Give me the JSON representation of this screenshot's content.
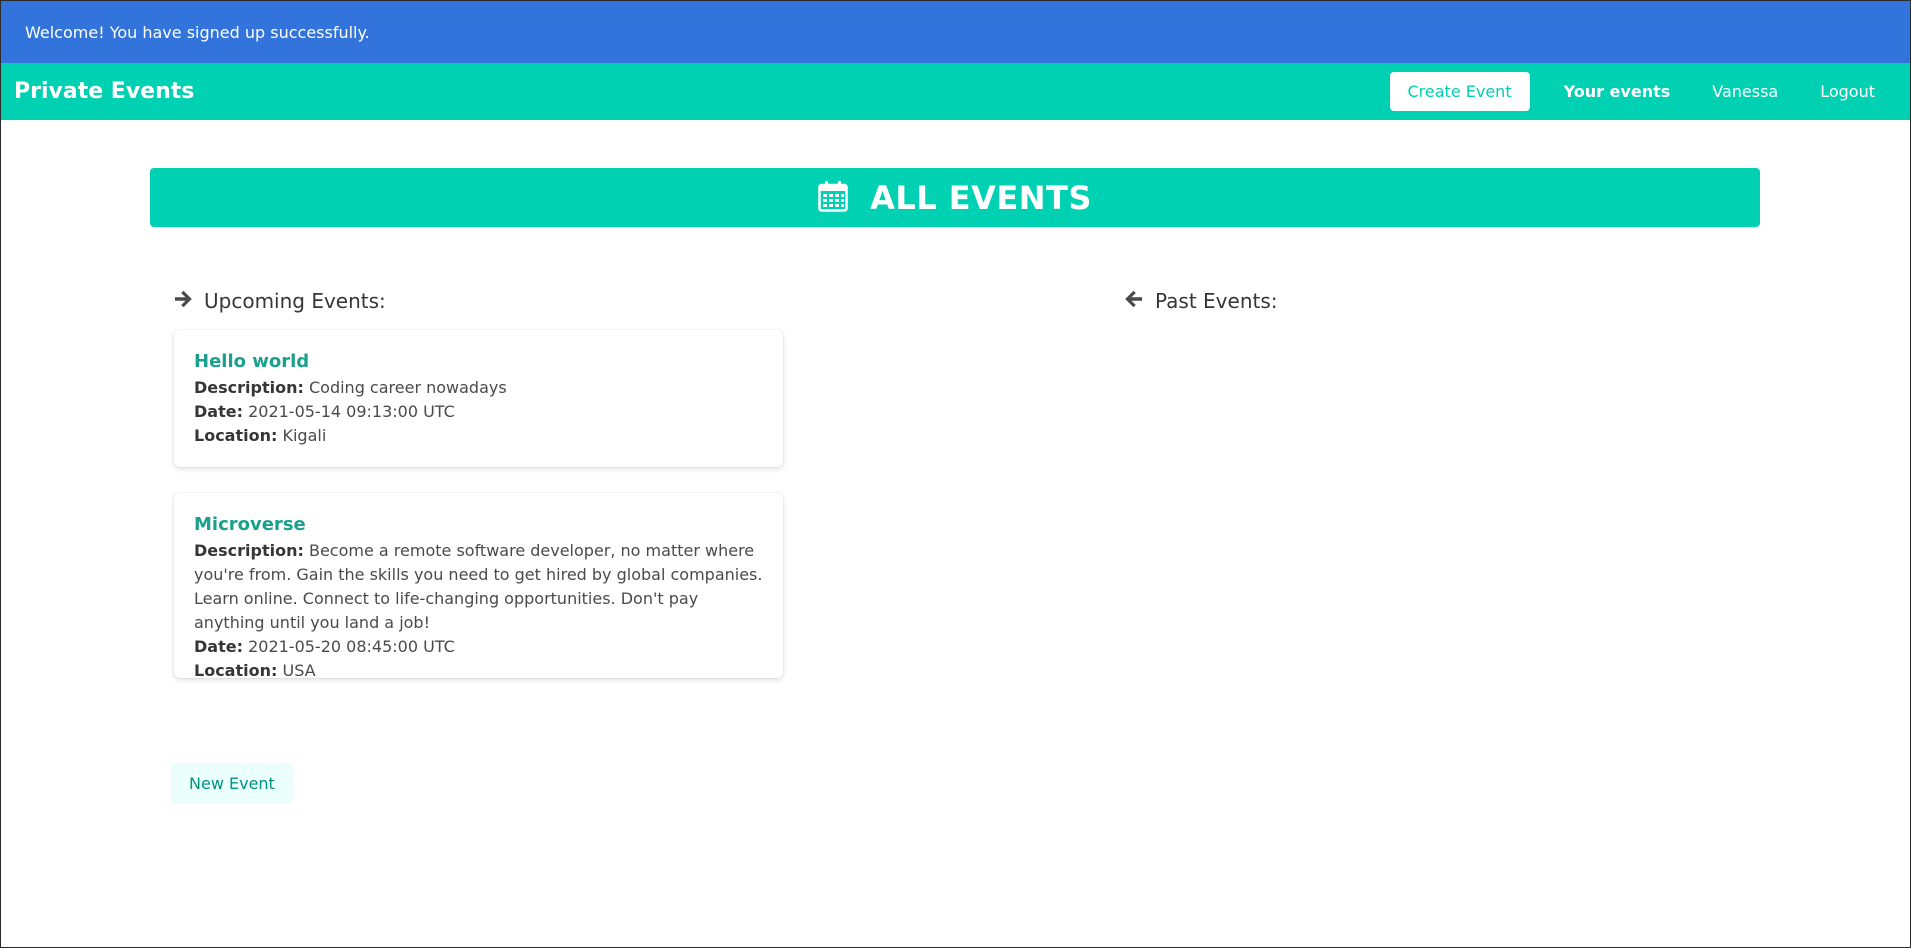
{
  "flash": {
    "message": "Welcome! You have signed up successfully."
  },
  "navbar": {
    "brand": "Private Events",
    "create_event": "Create Event",
    "your_events": "Your events",
    "user": "Vanessa",
    "logout": "Logout"
  },
  "hero": {
    "title": "ALL EVENTS",
    "icon": "calendar-icon"
  },
  "upcoming": {
    "heading": "Upcoming Events:",
    "icon": "arrow-right-icon",
    "events": [
      {
        "title": "Hello world",
        "description_label": "Description:",
        "description": "Coding career nowadays",
        "date_label": "Date:",
        "date": "2021-05-14 09:13:00 UTC",
        "location_label": "Location:",
        "location": "Kigali"
      },
      {
        "title": "Microverse",
        "description_label": "Description:",
        "description": "Become a remote software developer, no matter where you're from. Gain the skills you need to get hired by global companies. Learn online. Connect to life-changing opportunities. Don't pay anything until you land a job!",
        "date_label": "Date:",
        "date": "2021-05-20 08:45:00 UTC",
        "location_label": "Location:",
        "location": "USA"
      }
    ]
  },
  "past": {
    "heading": "Past Events:",
    "icon": "arrow-left-icon"
  },
  "actions": {
    "new_event": "New Event"
  },
  "colors": {
    "primary": "#00d1b2",
    "info": "#3273dc",
    "link": "#1aa08d"
  }
}
